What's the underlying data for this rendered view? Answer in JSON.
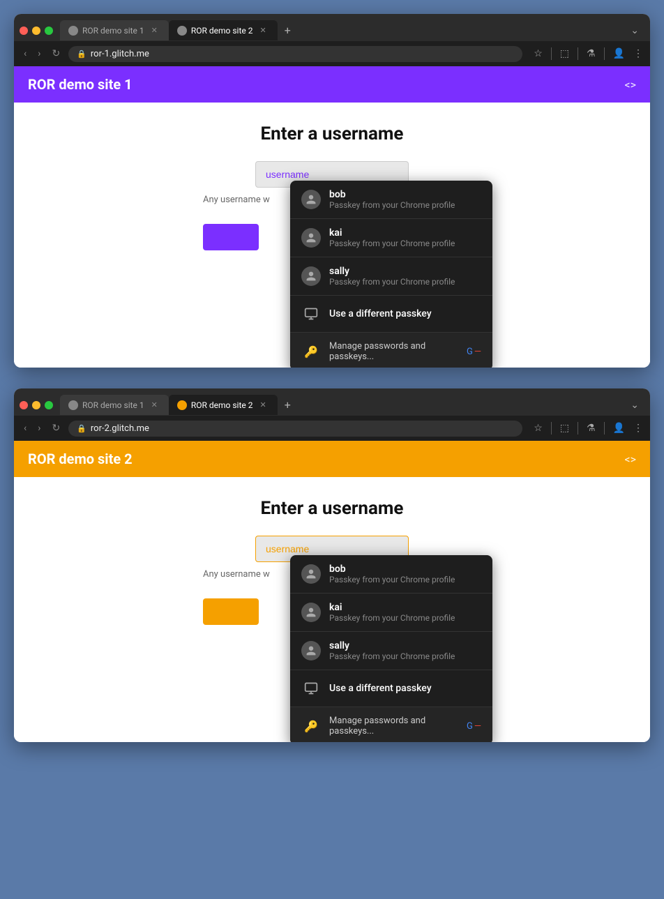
{
  "browser1": {
    "tab1": {
      "label": "ROR demo site 1",
      "active": false
    },
    "tab2": {
      "label": "ROR demo site 2",
      "active": true
    },
    "tab_new": "+",
    "url": "ror-1.glitch.me",
    "site_title": "ROR demo site 1",
    "code_icon": "<>",
    "page_heading": "Enter a username",
    "input_placeholder": "username",
    "any_username": "Any username w",
    "passkey_dropdown": {
      "items": [
        {
          "name": "bob",
          "sub": "Passkey from your Chrome profile"
        },
        {
          "name": "kai",
          "sub": "Passkey from your Chrome profile"
        },
        {
          "name": "sally",
          "sub": "Passkey from your Chrome profile"
        }
      ],
      "different_passkey": "Use a different passkey",
      "manage": "Manage passwords and passkeys...",
      "arrow_color": "#7b2fff"
    },
    "accent_color": "#7b2fff"
  },
  "browser2": {
    "tab1": {
      "label": "ROR demo site 1",
      "active": false
    },
    "tab2": {
      "label": "ROR demo site 2",
      "active": true
    },
    "tab_new": "+",
    "url": "ror-2.glitch.me",
    "site_title": "ROR demo site 2",
    "code_icon": "<>",
    "page_heading": "Enter a username",
    "input_placeholder": "username",
    "any_username": "Any username w",
    "passkey_dropdown": {
      "items": [
        {
          "name": "bob",
          "sub": "Passkey from your Chrome profile"
        },
        {
          "name": "kai",
          "sub": "Passkey from your Chrome profile"
        },
        {
          "name": "sally",
          "sub": "Passkey from your Chrome profile"
        }
      ],
      "different_passkey": "Use a different passkey",
      "manage": "Manage passwords and passkeys...",
      "arrow_color": "#f5a000"
    },
    "accent_color": "#f5a000"
  }
}
